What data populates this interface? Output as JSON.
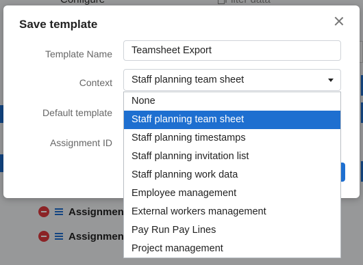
{
  "background": {
    "top_left_label": "Configure",
    "top_right_label": "Filter data",
    "rows": [
      {
        "label": "Assignment"
      },
      {
        "label": "Assignment"
      }
    ]
  },
  "dialog": {
    "title": "Save template",
    "fields": {
      "template_name_label": "Template Name",
      "template_name_value": "Teamsheet Export",
      "context_label": "Context",
      "context_value": "Staff planning team sheet",
      "default_template_label": "Default template",
      "assignment_id_label": "Assignment ID"
    }
  },
  "dropdown": {
    "options": [
      "None",
      "Staff planning team sheet",
      "Staff planning timestamps",
      "Staff planning invitation list",
      "Staff planning work data",
      "Employee management",
      "External workers management",
      "Pay Run Pay Lines",
      "Project management"
    ],
    "selected": "Staff planning team sheet"
  },
  "colors": {
    "accent": "#1e6fd0",
    "danger": "#e0393e"
  }
}
